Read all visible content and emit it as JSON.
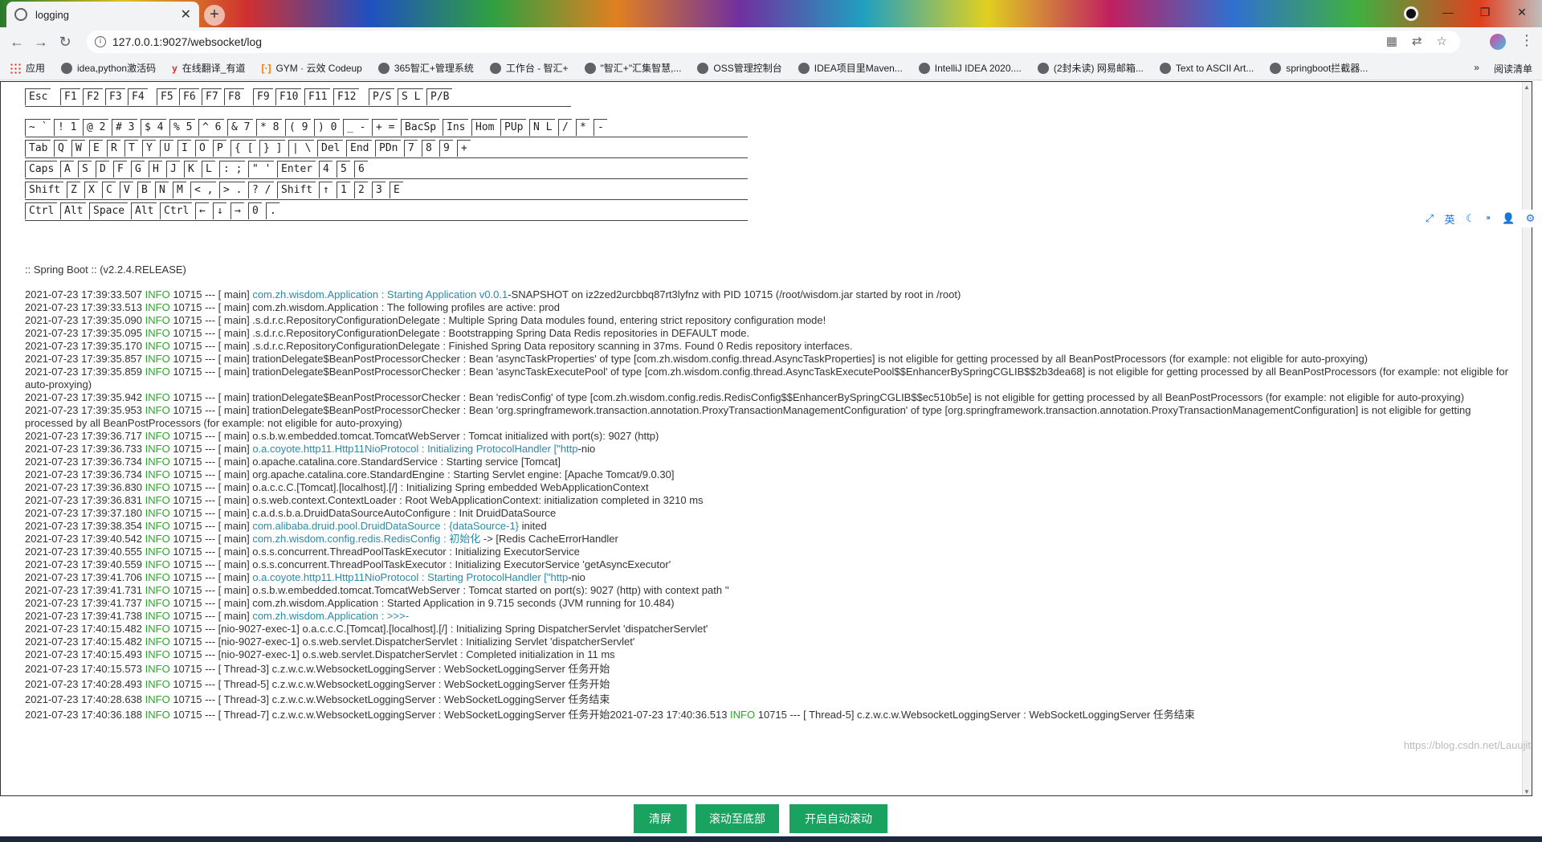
{
  "browser": {
    "tab_title": "logging",
    "url": "127.0.0.1:9027/websocket/log",
    "window_controls": [
      "—",
      "❐",
      "✕"
    ],
    "bookmarks": [
      {
        "label": "应用",
        "icon": "apps-grid-icon"
      },
      {
        "label": "idea,python激活码",
        "icon": "globe-icon"
      },
      {
        "label": "在线翻译_有道",
        "icon": "youdao-icon"
      },
      {
        "label": "GYM · 云效 Codeup",
        "icon": "codeup-icon"
      },
      {
        "label": "365智汇+管理系统",
        "icon": "globe-icon"
      },
      {
        "label": "工作台 - 智汇+",
        "icon": "globe-icon"
      },
      {
        "label": "\"智汇+\"汇集智慧,...",
        "icon": "globe-icon"
      },
      {
        "label": "OSS管理控制台",
        "icon": "globe-icon"
      },
      {
        "label": "IDEA项目里Maven...",
        "icon": "globe-icon"
      },
      {
        "label": "IntelliJ IDEA 2020....",
        "icon": "globe-icon"
      },
      {
        "label": "(2封未读) 网易邮箱...",
        "icon": "globe-icon"
      },
      {
        "label": "Text to ASCII Art...",
        "icon": "globe-icon"
      },
      {
        "label": "springboot拦截器...",
        "icon": "globe-icon"
      }
    ],
    "bookmarks_more": "»",
    "reading_list": "阅读清单"
  },
  "banner": {
    "row1": [
      "Esc",
      "F1",
      "F2",
      "F3",
      "F4",
      "F5",
      "F6",
      "F7",
      "F8",
      "F9",
      "F10",
      "F11",
      "F12",
      "P/S",
      "S L",
      "P/B"
    ],
    "row2": [
      "~ `",
      "! 1",
      "@ 2",
      "# 3",
      "$ 4",
      "% 5",
      "^ 6",
      "& 7",
      "* 8",
      "( 9",
      ") 0",
      "_ -",
      "+ =",
      "BacSp",
      "Ins",
      "Hom",
      "PUp",
      "N L",
      "/",
      "*",
      "-"
    ],
    "row3": [
      "Tab",
      "Q",
      "W",
      "E",
      "R",
      "T",
      "Y",
      "U",
      "I",
      "O",
      "P",
      "{ [",
      "} ]",
      "| \\",
      "Del",
      "End",
      "PDn",
      "7",
      "8",
      "9",
      "+"
    ],
    "row4": [
      "Caps",
      "A",
      "S",
      "D",
      "F",
      "G",
      "H",
      "J",
      "K",
      "L",
      ": ;",
      "\" '",
      "Enter",
      "4",
      "5",
      "6"
    ],
    "row5": [
      "Shift",
      "Z",
      "X",
      "C",
      "V",
      "B",
      "N",
      "M",
      "< ,",
      "> .",
      "? /",
      "Shift",
      "↑",
      "1",
      "2",
      "3",
      "E"
    ],
    "row6": [
      "Ctrl",
      "Alt",
      "Space",
      "Alt",
      "Ctrl",
      "←",
      "↓",
      "→",
      "0",
      "."
    ],
    "spring_version": ":: Spring Boot ::        (v2.2.4.RELEASE)"
  },
  "log_lines": [
    {
      "ts": "2021-07-23 17:39:33.507",
      "lvl": "INFO",
      "pre": " 10715 --- [ main] ",
      "hl": "com.zh.wisdom.Application : Starting Application v0.0.1",
      "post": "-SNAPSHOT on iz2zed2urcbbq87rt3lyfnz with PID 10715 (/root/wisdom.jar started by root in /root)"
    },
    {
      "ts": "2021-07-23 17:39:33.513",
      "lvl": "INFO",
      "pre": " 10715 --- [ main] com.zh.wisdom.Application : The following profiles are active: prod",
      "hl": "",
      "post": ""
    },
    {
      "ts": "2021-07-23 17:39:35.090",
      "lvl": "INFO",
      "pre": " 10715 --- [ main] .s.d.r.c.RepositoryConfigurationDelegate : Multiple Spring Data modules found, entering strict repository configuration mode!",
      "hl": "",
      "post": ""
    },
    {
      "ts": "2021-07-23 17:39:35.095",
      "lvl": "INFO",
      "pre": " 10715 --- [ main] .s.d.r.c.RepositoryConfigurationDelegate : Bootstrapping Spring Data Redis repositories in DEFAULT mode.",
      "hl": "",
      "post": ""
    },
    {
      "ts": "2021-07-23 17:39:35.170",
      "lvl": "INFO",
      "pre": " 10715 --- [ main] .s.d.r.c.RepositoryConfigurationDelegate : Finished Spring Data repository scanning in 37ms. Found 0 Redis repository interfaces.",
      "hl": "",
      "post": ""
    },
    {
      "ts": "2021-07-23 17:39:35.857",
      "lvl": "INFO",
      "pre": " 10715 --- [ main] trationDelegate$BeanPostProcessorChecker : Bean 'asyncTaskProperties' of type [com.zh.wisdom.config.thread.AsyncTaskProperties] is not eligible for getting processed by all BeanPostProcessors (for example: not eligible for auto-proxying)",
      "hl": "",
      "post": ""
    },
    {
      "ts": "2021-07-23 17:39:35.859",
      "lvl": "INFO",
      "pre": " 10715 --- [ main] trationDelegate$BeanPostProcessorChecker : Bean 'asyncTaskExecutePool' of type [com.zh.wisdom.config.thread.AsyncTaskExecutePool$$EnhancerBySpringCGLIB$$2b3dea68] is not eligible for getting processed by all BeanPostProcessors (for example: not eligible for auto-proxying)",
      "hl": "",
      "post": ""
    },
    {
      "ts": "2021-07-23 17:39:35.942",
      "lvl": "INFO",
      "pre": " 10715 --- [ main] trationDelegate$BeanPostProcessorChecker : Bean 'redisConfig' of type [com.zh.wisdom.config.redis.RedisConfig$$EnhancerBySpringCGLIB$$ec510b5e] is not eligible for getting processed by all BeanPostProcessors (for example: not eligible for auto-proxying)",
      "hl": "",
      "post": ""
    },
    {
      "ts": "2021-07-23 17:39:35.953",
      "lvl": "INFO",
      "pre": " 10715 --- [ main] trationDelegate$BeanPostProcessorChecker : Bean 'org.springframework.transaction.annotation.ProxyTransactionManagementConfiguration' of type [org.springframework.transaction.annotation.ProxyTransactionManagementConfiguration] is not eligible for getting processed by all BeanPostProcessors (for example: not eligible for auto-proxying)",
      "hl": "",
      "post": ""
    },
    {
      "ts": "2021-07-23 17:39:36.717",
      "lvl": "INFO",
      "pre": " 10715 --- [ main] o.s.b.w.embedded.tomcat.TomcatWebServer : Tomcat initialized with port(s): 9027 (http)",
      "hl": "",
      "post": ""
    },
    {
      "ts": "2021-07-23 17:39:36.733",
      "lvl": "INFO",
      "pre": " 10715 --- [ main] ",
      "hl": "o.a.coyote.http11.Http11NioProtocol : Initializing ProtocolHandler [\"http",
      "post": "-nio"
    },
    {
      "ts": "2021-07-23 17:39:36.734",
      "lvl": "INFO",
      "pre": " 10715 --- [ main] o.apache.catalina.core.StandardService : Starting service [Tomcat]",
      "hl": "",
      "post": ""
    },
    {
      "ts": "2021-07-23 17:39:36.734",
      "lvl": "INFO",
      "pre": " 10715 --- [ main] org.apache.catalina.core.StandardEngine : Starting Servlet engine: [Apache Tomcat/9.0.30]",
      "hl": "",
      "post": ""
    },
    {
      "ts": "2021-07-23 17:39:36.830",
      "lvl": "INFO",
      "pre": " 10715 --- [ main] o.a.c.c.C.[Tomcat].[localhost].[/] : Initializing Spring embedded WebApplicationContext",
      "hl": "",
      "post": ""
    },
    {
      "ts": "2021-07-23 17:39:36.831",
      "lvl": "INFO",
      "pre": " 10715 --- [ main] o.s.web.context.ContextLoader : Root WebApplicationContext: initialization completed in 3210 ms",
      "hl": "",
      "post": ""
    },
    {
      "ts": "2021-07-23 17:39:37.180",
      "lvl": "INFO",
      "pre": " 10715 --- [ main] c.a.d.s.b.a.DruidDataSourceAutoConfigure : Init DruidDataSource",
      "hl": "",
      "post": ""
    },
    {
      "ts": "2021-07-23 17:39:38.354",
      "lvl": "INFO",
      "pre": " 10715 --- [ main] ",
      "hl": "com.alibaba.druid.pool.DruidDataSource : {dataSource-1}",
      "post": " inited"
    },
    {
      "ts": "2021-07-23 17:39:40.542",
      "lvl": "INFO",
      "pre": " 10715 --- [ main] ",
      "hl": "com.zh.wisdom.config.redis.RedisConfig : 初始化",
      "post": " -> [Redis CacheErrorHandler"
    },
    {
      "ts": "2021-07-23 17:39:40.555",
      "lvl": "INFO",
      "pre": " 10715 --- [ main] o.s.s.concurrent.ThreadPoolTaskExecutor : Initializing ExecutorService",
      "hl": "",
      "post": ""
    },
    {
      "ts": "2021-07-23 17:39:40.559",
      "lvl": "INFO",
      "pre": " 10715 --- [ main] o.s.s.concurrent.ThreadPoolTaskExecutor : Initializing ExecutorService 'getAsyncExecutor'",
      "hl": "",
      "post": ""
    },
    {
      "ts": "2021-07-23 17:39:41.706",
      "lvl": "INFO",
      "pre": " 10715 --- [ main] ",
      "hl": "o.a.coyote.http11.Http11NioProtocol : Starting ProtocolHandler [\"http",
      "post": "-nio"
    },
    {
      "ts": "2021-07-23 17:39:41.731",
      "lvl": "INFO",
      "pre": " 10715 --- [ main] o.s.b.w.embedded.tomcat.TomcatWebServer : Tomcat started on port(s): 9027 (http) with context path ''",
      "hl": "",
      "post": ""
    },
    {
      "ts": "2021-07-23 17:39:41.737",
      "lvl": "INFO",
      "pre": " 10715 --- [ main] com.zh.wisdom.Application : Started Application in 9.715 seconds (JVM running for 10.484)",
      "hl": "",
      "post": ""
    },
    {
      "ts": "2021-07-23 17:39:41.738",
      "lvl": "INFO",
      "pre": " 10715 --- [ main] ",
      "hl": "com.zh.wisdom.Application : >>>-",
      "post": ""
    },
    {
      "ts": "2021-07-23 17:40:15.482",
      "lvl": "INFO",
      "pre": " 10715 --- [nio-9027-exec-1] o.a.c.c.C.[Tomcat].[localhost].[/] : Initializing Spring DispatcherServlet 'dispatcherServlet'",
      "hl": "",
      "post": ""
    },
    {
      "ts": "2021-07-23 17:40:15.482",
      "lvl": "INFO",
      "pre": " 10715 --- [nio-9027-exec-1] o.s.web.servlet.DispatcherServlet : Initializing Servlet 'dispatcherServlet'",
      "hl": "",
      "post": ""
    },
    {
      "ts": "2021-07-23 17:40:15.493",
      "lvl": "INFO",
      "pre": " 10715 --- [nio-9027-exec-1] o.s.web.servlet.DispatcherServlet : Completed initialization in 11 ms",
      "hl": "",
      "post": ""
    },
    {
      "ts": "2021-07-23 17:40:15.573",
      "lvl": "INFO",
      "pre": " 10715 --- [ Thread-3] c.z.w.c.w.WebsocketLoggingServer : WebSocketLoggingServer 任务开始",
      "hl": "",
      "post": "",
      "tall": true
    },
    {
      "ts": "2021-07-23 17:40:28.493",
      "lvl": "INFO",
      "pre": " 10715 --- [ Thread-5] c.z.w.c.w.WebsocketLoggingServer : WebSocketLoggingServer 任务开始",
      "hl": "",
      "post": "",
      "tall": true
    },
    {
      "ts": "2021-07-23 17:40:28.638",
      "lvl": "INFO",
      "pre": " 10715 --- [ Thread-3] c.z.w.c.w.WebsocketLoggingServer : WebSocketLoggingServer 任务结束",
      "hl": "",
      "post": "",
      "tall": true
    },
    {
      "ts": "2021-07-23 17:40:36.188",
      "lvl": "INFO",
      "pre": " 10715 --- [ Thread-7] c.z.w.c.w.WebsocketLoggingServer : WebSocketLoggingServer 任务开始2021-07-23 17:40:36.513 ",
      "hl": "",
      "post": "",
      "lvl2": "INFO",
      "post2": " 10715 --- [ Thread-5] c.z.w.c.w.WebsocketLoggingServer : WebSocketLoggingServer 任务结束",
      "tall": true
    }
  ],
  "float_tools": [
    "⤢",
    "英",
    "☾",
    "⁍",
    "👤",
    "⚙"
  ],
  "buttons": {
    "clear": "清屏",
    "scroll_bottom": "滚动至底部",
    "auto_scroll": "开启自动滚动"
  },
  "watermark": "https://blog.csdn.net/Lauujit"
}
